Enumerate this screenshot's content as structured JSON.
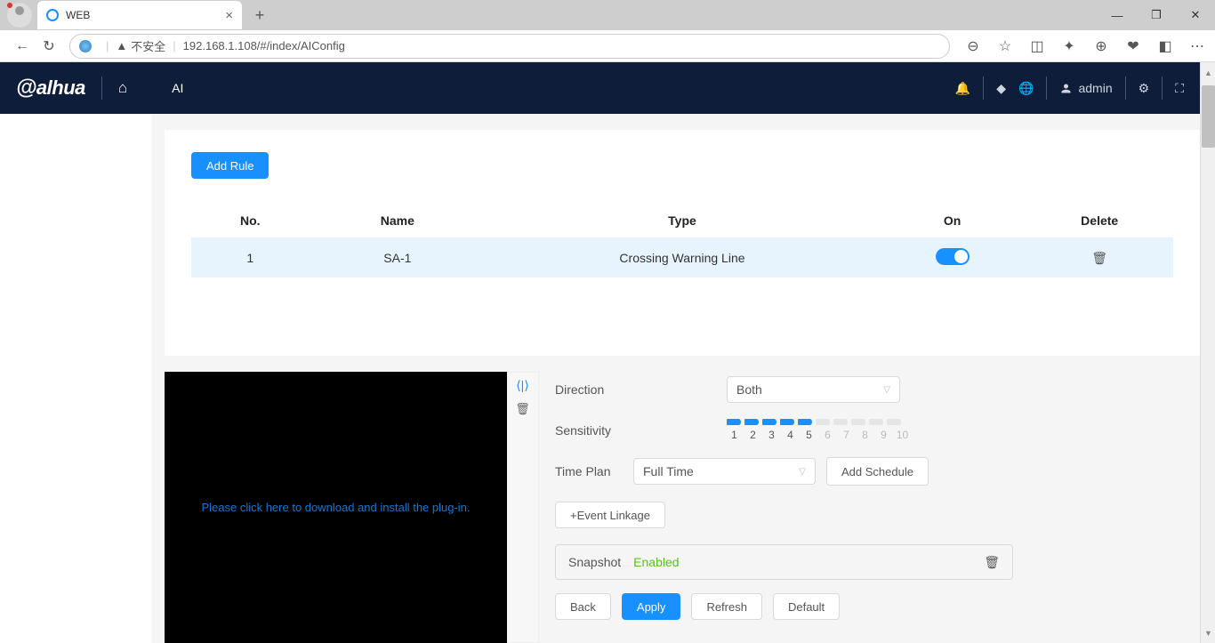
{
  "browser": {
    "tab_title": "WEB",
    "insecure_label": "不安全",
    "url": "192.168.1.108/#/index/AIConfig"
  },
  "header": {
    "logo": "alhua",
    "nav_ai": "AI",
    "username": "admin"
  },
  "buttons": {
    "add_rule": "Add Rule",
    "add_schedule": "Add Schedule",
    "event_linkage": "+Event Linkage",
    "back": "Back",
    "apply": "Apply",
    "refresh": "Refresh",
    "default": "Default"
  },
  "table": {
    "headers": {
      "no": "No.",
      "name": "Name",
      "type": "Type",
      "on": "On",
      "delete": "Delete"
    },
    "row": {
      "no": "1",
      "name": "SA-1",
      "type": "Crossing Warning Line"
    }
  },
  "preview_link": "Please click here to download and install the plug-in.",
  "config": {
    "direction_label": "Direction",
    "direction_value": "Both",
    "sensitivity_label": "Sensitivity",
    "sensitivity_value": 5,
    "timeplan_label": "Time Plan",
    "timeplan_value": "Full Time",
    "snapshot_label": "Snapshot",
    "snapshot_status": "Enabled"
  }
}
